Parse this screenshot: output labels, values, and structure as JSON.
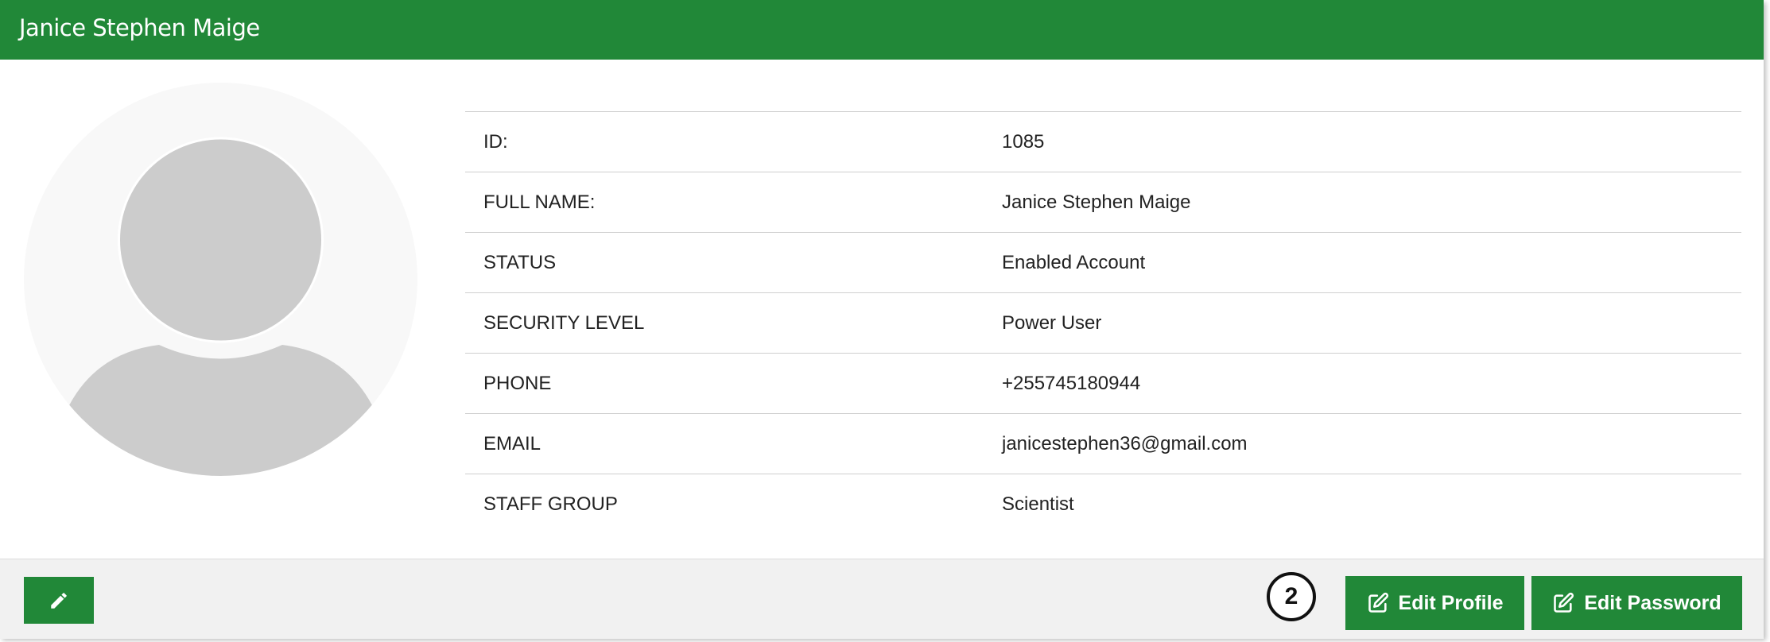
{
  "header": {
    "title": "Janice Stephen Maige"
  },
  "avatar": {
    "icon": "user-placeholder-icon"
  },
  "profile_rows": [
    {
      "label": "ID:",
      "value": "1085"
    },
    {
      "label": "FULL NAME:",
      "value": "Janice Stephen Maige"
    },
    {
      "label": "STATUS",
      "value": "Enabled Account"
    },
    {
      "label": "SECURITY LEVEL",
      "value": "Power User"
    },
    {
      "label": "PHONE",
      "value": "+255745180944"
    },
    {
      "label": "EMAIL",
      "value": "janicestephen36@gmail.com"
    },
    {
      "label": "STAFF GROUP",
      "value": "Scientist"
    }
  ],
  "footer": {
    "edit_icon": "pencil-icon",
    "badge_number": "2",
    "edit_profile_label": "Edit Profile",
    "edit_password_label": "Edit Password"
  },
  "colors": {
    "accent": "#218838",
    "footer_bg": "#f1f1f1",
    "avatar_bg": "#f8f8f8",
    "avatar_fg": "#cccccc"
  }
}
